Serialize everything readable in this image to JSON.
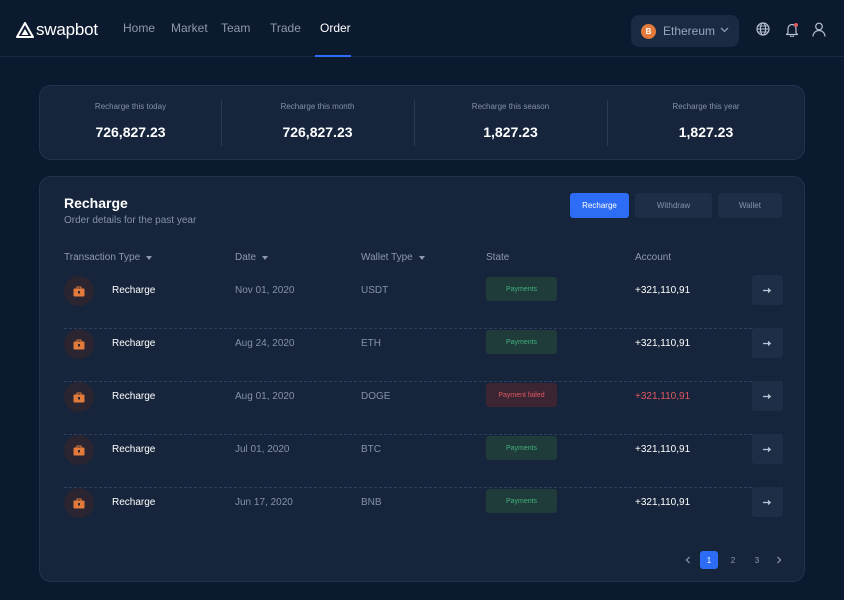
{
  "header": {
    "brand": "swapbot",
    "nav": [
      {
        "label": "Home"
      },
      {
        "label": "Market"
      },
      {
        "label": "Team"
      },
      {
        "label": "Trade"
      },
      {
        "label": "Order"
      }
    ],
    "active_nav": "Order",
    "network": {
      "label": "Ethereum",
      "coin_symbol": "B",
      "coin_icon": "bitcoin-coin-icon"
    },
    "icons": [
      "globe-icon",
      "bell-icon",
      "user-icon"
    ]
  },
  "stats": [
    {
      "label": "Recharge this today",
      "value": "726,827.23"
    },
    {
      "label": "Recharge this month",
      "value": "726,827.23"
    },
    {
      "label": "Recharge this season",
      "value": "1,827.23"
    },
    {
      "label": "Recharge this year",
      "value": "1,827.23"
    }
  ],
  "panel": {
    "title": "Recharge",
    "subtitle": "Order details for the past year",
    "tabs": [
      {
        "label": "Recharge"
      },
      {
        "label": "Withdraw"
      },
      {
        "label": "Wallet"
      }
    ],
    "active_tab": "Recharge",
    "columns": [
      {
        "label": "Transaction Type"
      },
      {
        "label": "Date"
      },
      {
        "label": "Wallet Type"
      },
      {
        "label": "State"
      },
      {
        "label": "Account"
      }
    ],
    "rows": [
      {
        "type": "Recharge",
        "date": "Nov 01, 2020",
        "wallet": "USDT",
        "state": "Payments",
        "account": "+321,110,91"
      },
      {
        "type": "Recharge",
        "date": "Aug 24, 2020",
        "wallet": "ETH",
        "state": "Payments",
        "account": "+321,110,91"
      },
      {
        "type": "Recharge",
        "date": "Aug 01, 2020",
        "wallet": "DOGE",
        "state": "Payment failed",
        "account": "+321,110,91"
      },
      {
        "type": "Recharge",
        "date": "Jul 01, 2020",
        "wallet": "BTC",
        "state": "Payments",
        "account": "+321,110,91"
      },
      {
        "type": "Recharge",
        "date": "Jun 17, 2020",
        "wallet": "BNB",
        "state": "Payments",
        "account": "+321,110,91"
      }
    ],
    "pagination": {
      "pages": [
        "1",
        "2",
        "3"
      ],
      "current": "1"
    }
  },
  "colors": {
    "background": "#0c1a30",
    "accent": "#2d6cf5",
    "success": "#43b07c",
    "danger": "#e0585f",
    "coin": "#e27a3b"
  }
}
